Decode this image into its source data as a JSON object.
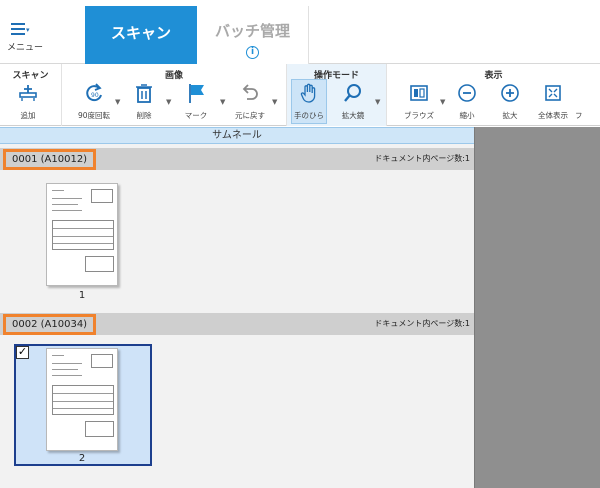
{
  "menu": {
    "label": "メニュー",
    "icon": "hamburger-menu-icon"
  },
  "tabs": [
    {
      "label": "スキャン",
      "active": true
    },
    {
      "label": "バッチ管理",
      "active": false,
      "icon": "info-icon",
      "icon_glyph": "i"
    }
  ],
  "ribbon": {
    "groups": [
      {
        "title": "スキャン",
        "tools": [
          {
            "label": "追加",
            "icon": "scanner-add-icon"
          }
        ]
      },
      {
        "title": "画像",
        "tools": [
          {
            "label": "90度回転",
            "icon": "rotate-90-icon"
          },
          {
            "label": "削除",
            "icon": "trash-icon"
          },
          {
            "label": "マーク",
            "icon": "flag-icon"
          },
          {
            "label": "元に戻す",
            "icon": "undo-icon"
          }
        ]
      },
      {
        "title": "操作モード",
        "tools": [
          {
            "label": "手のひら",
            "icon": "hand-icon",
            "selected": true
          },
          {
            "label": "拡大鏡",
            "icon": "magnifier-icon"
          }
        ]
      },
      {
        "title": "表示",
        "tools": [
          {
            "label": "ブラウズ",
            "icon": "browse-icon"
          },
          {
            "label": "縮小",
            "icon": "zoom-out-icon"
          },
          {
            "label": "拡大",
            "icon": "zoom-in-icon"
          },
          {
            "label": "全体表示",
            "icon": "fit-to-window-icon"
          },
          {
            "label": "フ",
            "icon": "clipped-tool-icon"
          }
        ]
      }
    ]
  },
  "thumbnail_panel": {
    "title": "サムネール"
  },
  "batches": [
    {
      "id": "0001 (A10012)",
      "page_count_label": "ドキュメント内ページ数:1",
      "pages": [
        {
          "number": "1",
          "selected": false
        }
      ]
    },
    {
      "id": "0002 (A10034)",
      "page_count_label": "ドキュメント内ページ数:1",
      "pages": [
        {
          "number": "2",
          "selected": true,
          "checkmark": "✓"
        }
      ]
    }
  ],
  "colors": {
    "accent": "#1f8fd6",
    "highlight_frame": "#f0822d",
    "selected_border": "#1d3f8e",
    "header_blue": "#cfe6f8",
    "right_pane": "#8f8f8f"
  }
}
